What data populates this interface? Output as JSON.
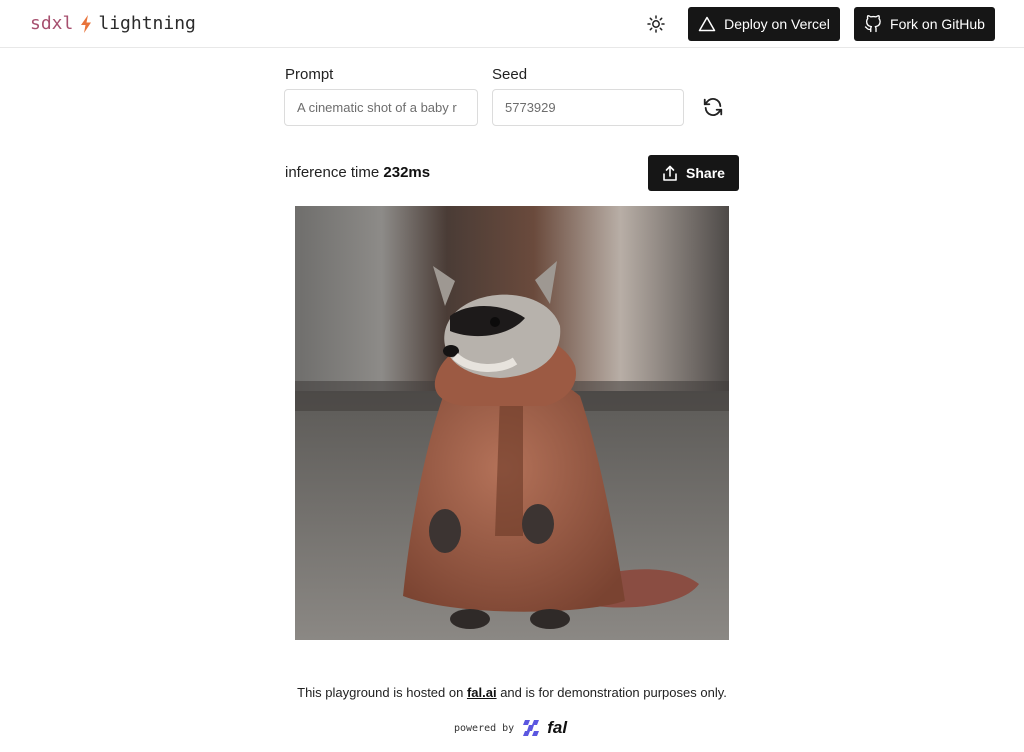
{
  "header": {
    "logo_part1": "sdxl",
    "logo_part2": "lightning",
    "deploy_label": "Deploy on Vercel",
    "fork_label": "Fork on GitHub",
    "icons": {
      "theme": "sun-icon",
      "deploy": "triangle-icon",
      "fork": "github-icon"
    }
  },
  "form": {
    "prompt_label": "Prompt",
    "prompt_value": "A cinematic shot of a baby r",
    "seed_label": "Seed",
    "seed_value": "5773929",
    "refresh_icon": "refresh-icon"
  },
  "result": {
    "inference_prefix": "inference time",
    "inference_value": "232ms",
    "share_label": "Share",
    "share_icon": "share-icon",
    "image_subject": "raccoon in a brown embroidered robe"
  },
  "footer": {
    "text_before": "This playground is hosted on ",
    "link_text": "fal.ai",
    "text_after": " and is for demonstration purposes only.",
    "powered_by": "powered by",
    "brand": "fal"
  },
  "colors": {
    "logo_accent": "#a7506f",
    "bolt": "#e8743b",
    "button_bg": "#161616"
  }
}
